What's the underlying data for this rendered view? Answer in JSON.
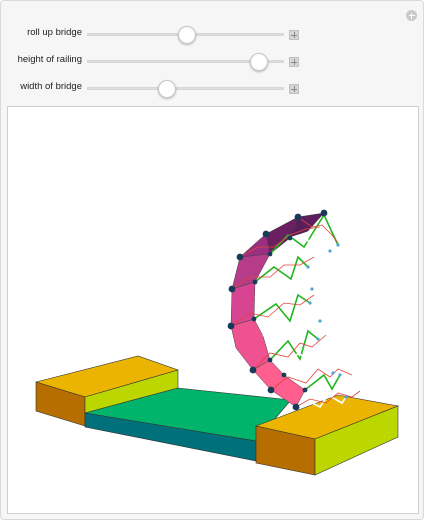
{
  "controls": [
    {
      "label": "roll up bridge",
      "value": 0.5
    },
    {
      "label": "height of railing",
      "value": 0.87
    },
    {
      "label": "width of bridge",
      "value": 0.4
    }
  ],
  "colors": {
    "platform_top": "#ebb400",
    "platform_front": "#b66e00",
    "platform_side": "#bcd600",
    "deck_top": "#00b46c",
    "deck_side": "#00707a",
    "arch_top": "#6a1f62",
    "arch_bottom": "#ff5f8f",
    "rail_green": "#1fb61f",
    "rail_white": "#ffffff",
    "node": "#183a5a"
  },
  "icons": [
    "plus-circle-icon",
    "plus-icon"
  ]
}
